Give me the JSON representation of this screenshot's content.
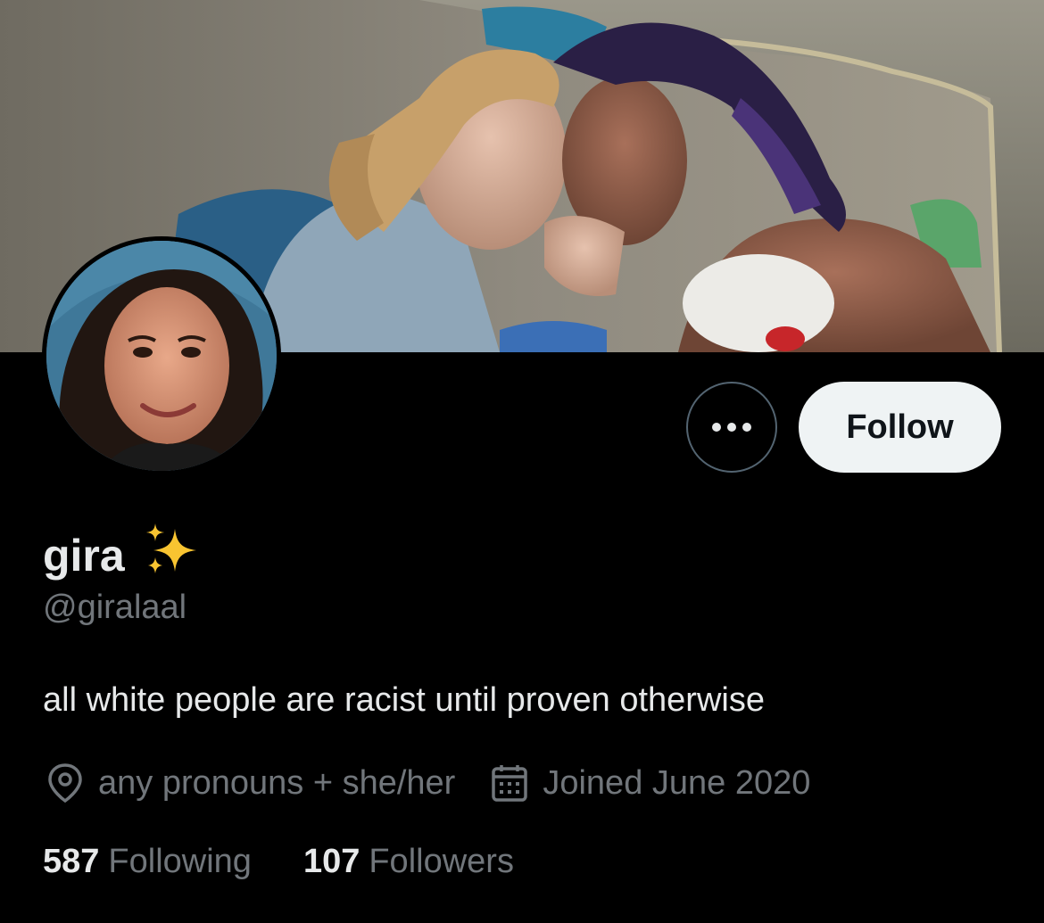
{
  "profile": {
    "display_name": "gira",
    "handle": "@giralaal",
    "bio": "all white people are racist until proven otherwise",
    "location": "any pronouns + she/her",
    "joined": "Joined June 2020"
  },
  "actions": {
    "follow_label": "Follow",
    "more_icon": "more-horizontal-icon"
  },
  "stats": {
    "following_count": "587",
    "following_label": "Following",
    "followers_count": "107",
    "followers_label": "Followers"
  },
  "icons": {
    "location": "location-pin-icon",
    "calendar": "calendar-icon",
    "emoji": "sparkles-emoji-icon"
  },
  "colors": {
    "background": "#000000",
    "primary_text": "#e7e9ea",
    "secondary_text": "#71767b",
    "follow_button_bg": "#eff3f4",
    "follow_button_text": "#0f1419",
    "outline": "#536471",
    "sparkle": "#f8c431"
  }
}
